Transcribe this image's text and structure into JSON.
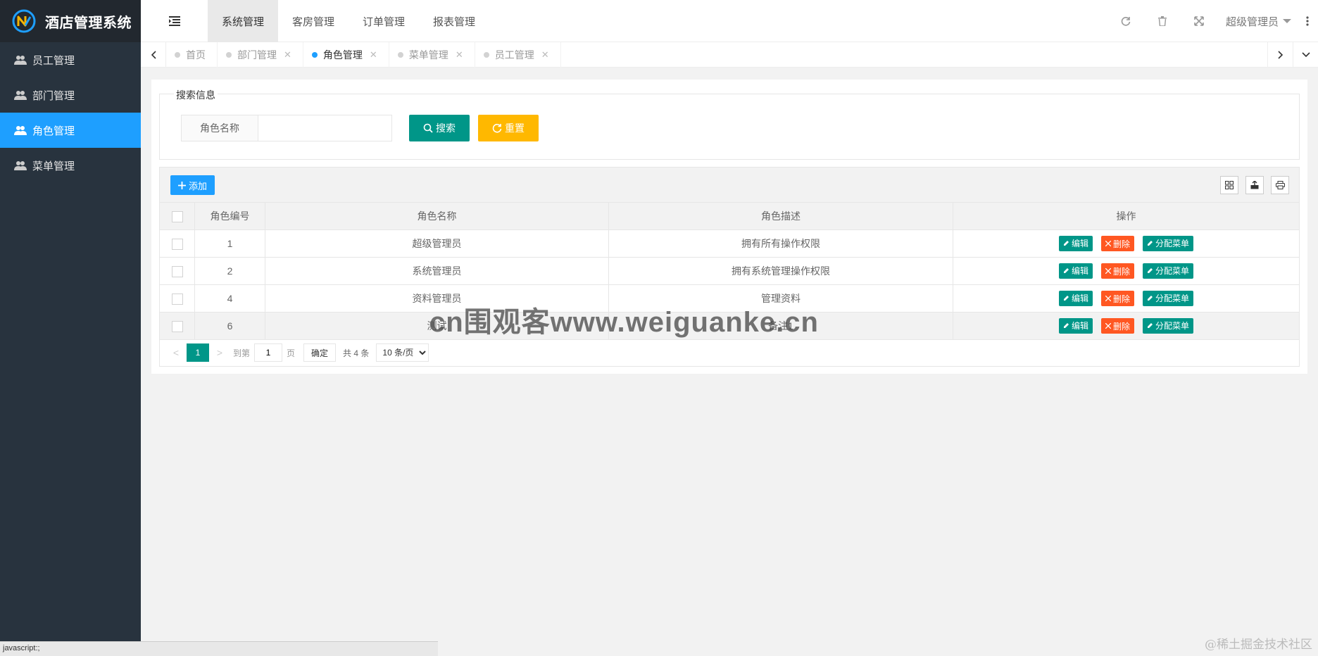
{
  "app": {
    "title": "酒店管理系统"
  },
  "sidebar": {
    "items": [
      {
        "label": "员工管理"
      },
      {
        "label": "部门管理"
      },
      {
        "label": "角色管理"
      },
      {
        "label": "菜单管理"
      }
    ],
    "active_index": 2
  },
  "header": {
    "top_tabs": [
      {
        "label": "系统管理"
      },
      {
        "label": "客房管理"
      },
      {
        "label": "订单管理"
      },
      {
        "label": "报表管理"
      }
    ],
    "active_tab": 0,
    "user": "超级管理员",
    "icons": [
      "refresh-icon",
      "trash-icon",
      "fullscreen-icon"
    ]
  },
  "page_tabs": [
    {
      "label": "首页",
      "closable": false
    },
    {
      "label": "部门管理",
      "closable": true
    },
    {
      "label": "角色管理",
      "closable": true
    },
    {
      "label": "菜单管理",
      "closable": true
    },
    {
      "label": "员工管理",
      "closable": true
    }
  ],
  "active_page_tab": 2,
  "search": {
    "legend": "搜索信息",
    "field_label": "角色名称",
    "field_value": "",
    "search_label": "搜索",
    "reset_label": "重置"
  },
  "toolbar": {
    "add_label": "添加"
  },
  "table": {
    "columns": [
      "角色编号",
      "角色名称",
      "角色描述",
      "操作"
    ],
    "rows": [
      {
        "id": "1",
        "name": "超级管理员",
        "desc": "拥有所有操作权限"
      },
      {
        "id": "2",
        "name": "系统管理员",
        "desc": "拥有系统管理操作权限"
      },
      {
        "id": "4",
        "name": "资料管理员",
        "desc": "管理资料"
      },
      {
        "id": "6",
        "name": "测试",
        "desc": "备注1"
      }
    ],
    "actions": {
      "edit": "编辑",
      "delete": "删除",
      "assign": "分配菜单"
    }
  },
  "pager": {
    "current": "1",
    "goto_text": "到第",
    "page_input": "1",
    "page_unit": "页",
    "confirm": "确定",
    "total": "共 4 条",
    "page_size": "10 条/页"
  },
  "watermark": "cn围观客www.weiguanke.cn",
  "status_bar": "javascript:;",
  "corner_credit": "@稀土掘金技术社区",
  "colors": {
    "sidebar_bg": "#28333e",
    "accent_blue": "#1e9fff",
    "primary_green": "#009688",
    "warning_yellow": "#ffb800",
    "danger_orange": "#ff5722"
  }
}
